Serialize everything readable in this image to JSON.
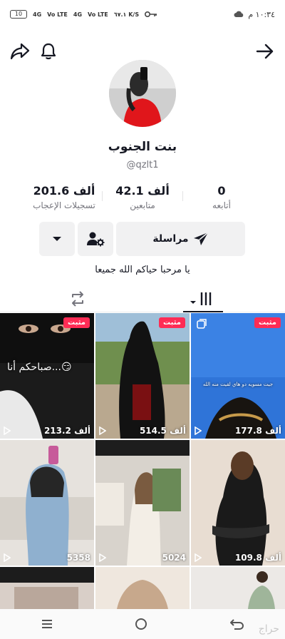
{
  "status_bar": {
    "time": "١٠:٣٤ م",
    "network_1": "4G",
    "network_2": "4G",
    "volte_1": "Vo LTE",
    "volte_2": "Vo LTE",
    "speed": "٦٧.١ K/S",
    "battery": "10"
  },
  "profile": {
    "name": "بنت الجنوب",
    "handle": "@qzlt1",
    "bio": "يا مرحبا حياكم الله جميعا"
  },
  "stats": {
    "following_value": "0",
    "following_label": "أتابعه",
    "followers_value": "42.1 ألف",
    "followers_label": "متابعين",
    "likes_value": "201.6 ألف",
    "likes_label": "تسجيلات الإعجاب"
  },
  "actions": {
    "message_label": "مراسلة"
  },
  "grid": {
    "pinned_label": "مثبت",
    "videos": [
      {
        "views": "213.2 ألف",
        "overlay": "صباحكم أنا...😏"
      },
      {
        "views": "514.5 ألف"
      },
      {
        "views": "177.8 ألف",
        "overlay": "جيت مسويه دو هاي لقيت منه الله"
      },
      {
        "views": "5358"
      },
      {
        "views": "5024"
      },
      {
        "views": "109.8 ألف"
      }
    ]
  },
  "watermark": "حراج"
}
